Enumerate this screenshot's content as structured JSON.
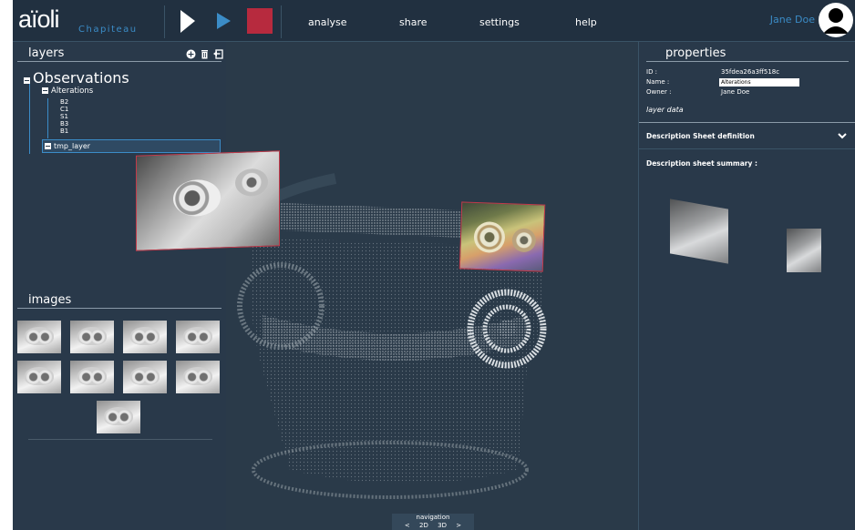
{
  "topbar": {
    "logo": "aïoli",
    "project": "Chapiteau",
    "menu": [
      "analyse",
      "share",
      "settings",
      "help"
    ],
    "user_name": "Jane Doe",
    "record_color": "#b72a3e",
    "accent": "#3b8cc7"
  },
  "layers": {
    "title": "layers",
    "tool_icons": [
      "add-icon",
      "trash-icon",
      "import-icon"
    ],
    "tree": {
      "root": "Observations",
      "group": "Alterations",
      "children": [
        "B2",
        "C1",
        "S1",
        "B3",
        "B1"
      ],
      "selected": "tmp_layer"
    }
  },
  "images": {
    "title": "images",
    "count": 9
  },
  "navigation": {
    "title": "navigation",
    "prev": "<",
    "mode_2d": "2D",
    "mode_3d": "3D",
    "next": ">"
  },
  "properties": {
    "title": "properties",
    "id_label": "ID :",
    "id_value": "35fdea26a3ff518c",
    "name_label": "Name :",
    "name_value": "Alterations",
    "owner_label": "Owner :",
    "owner_value": "Jane Doe",
    "layer_data": "layer data",
    "description_definition": "Description Sheet definition",
    "description_summary": "Description sheet summary :"
  }
}
